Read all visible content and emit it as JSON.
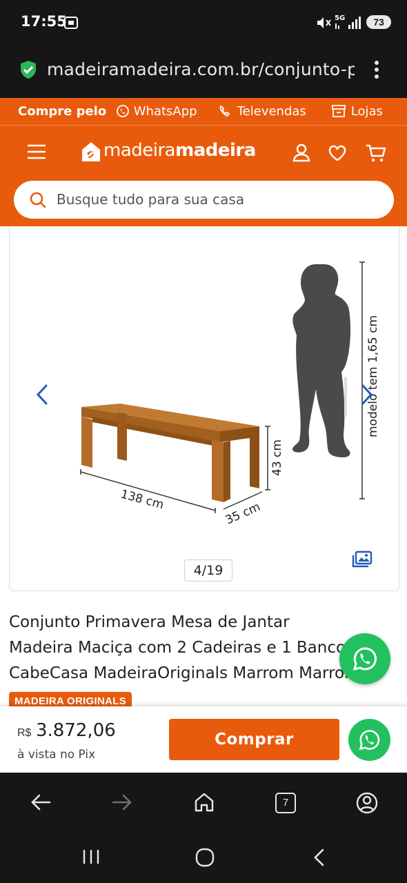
{
  "status_bar": {
    "time": "17:55",
    "battery": "73",
    "network": "5G"
  },
  "browser": {
    "url": "madeiramadeira.com.br/conjunto-primavera-mesa-de-jantar",
    "tabs_count": "7"
  },
  "top_strip": {
    "buy_via": "Compre pelo",
    "whatsapp": "WhatsApp",
    "televendas": "Televendas",
    "lojas": "Lojas"
  },
  "header": {
    "logo_text_light": "madeira",
    "logo_text_bold": "madeira",
    "search_placeholder": "Busque tudo para sua casa"
  },
  "gallery": {
    "counter": "4/19",
    "dim_width": "138 cm",
    "dim_depth": "35 cm",
    "dim_height": "43 cm",
    "model_height": "modelo tem 1,65 cm"
  },
  "product": {
    "title_line1": "Conjunto Primavera Mesa de Jantar",
    "title_line2": "Madeira Maciça com 2 Cadeiras e 1 Banco",
    "title_line3": "CabeCasa MadeiraOriginals Marrom Marrom",
    "badge": "MADEIRA ORIGINALS"
  },
  "buy_bar": {
    "currency": "R$",
    "price": "3.872,06",
    "payment_note": "à vista no Pix",
    "buy_label": "Comprar"
  },
  "colors": {
    "brand_orange": "#e95b0c",
    "whatsapp_green": "#22c15e",
    "dark_chrome": "#161617",
    "link_blue": "#1e5bb8"
  }
}
